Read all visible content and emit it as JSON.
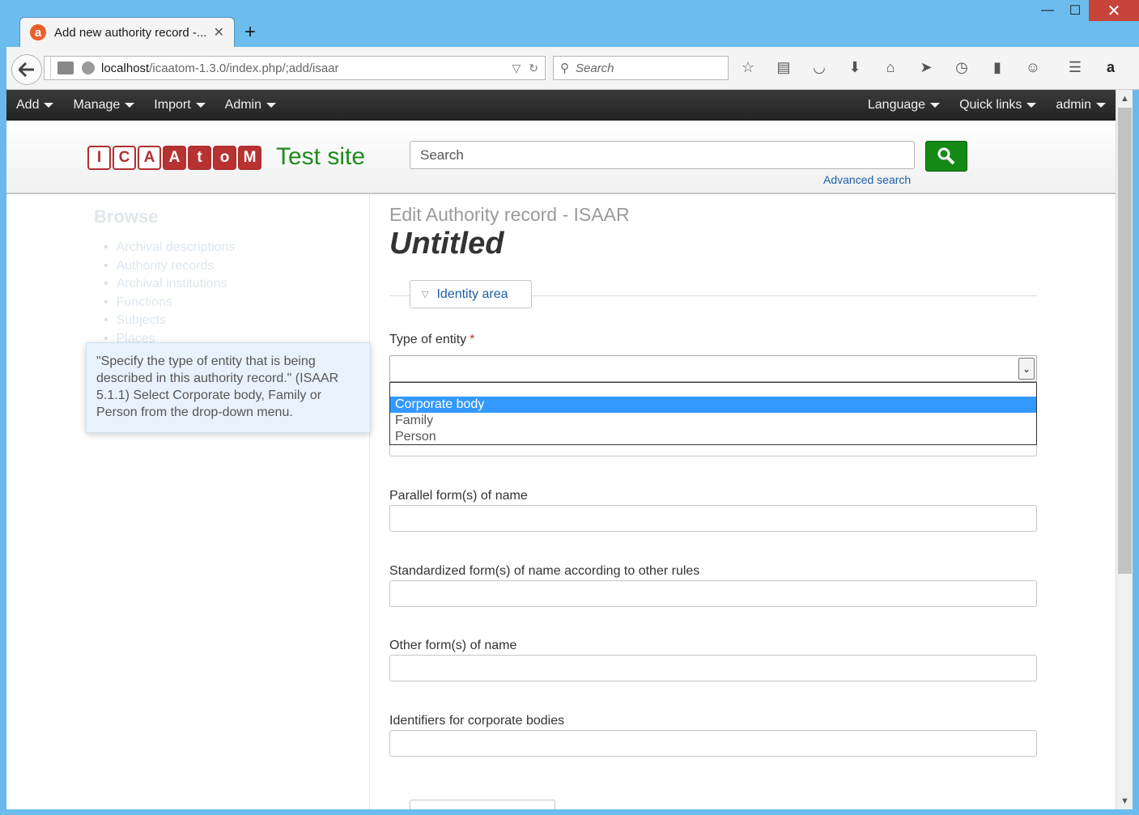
{
  "browser": {
    "tab_title": "Add new authority record -...",
    "tab_favicon": "a",
    "new_tab_label": "+",
    "url_host": "localhost",
    "url_path": "/icaatom-1.3.0/index.php/;add/isaar",
    "search_placeholder": "Search",
    "minimize": "—",
    "maximize": "☐",
    "close": "✕"
  },
  "topnav": {
    "left": [
      {
        "label": "Add"
      },
      {
        "label": "Manage"
      },
      {
        "label": "Import"
      },
      {
        "label": "Admin"
      }
    ],
    "right": [
      {
        "label": "Language"
      },
      {
        "label": "Quick links"
      },
      {
        "label": "admin"
      }
    ]
  },
  "header": {
    "logo_letters": [
      "I",
      "C",
      "A",
      "A",
      "t",
      "o",
      "M"
    ],
    "site_title": "Test site",
    "search_placeholder": "Search",
    "advanced_search": "Advanced search"
  },
  "sidebar": {
    "title": "Browse",
    "items": [
      {
        "label": "Archival descriptions"
      },
      {
        "label": "Authority records"
      },
      {
        "label": "Archival institutions"
      },
      {
        "label": "Functions"
      },
      {
        "label": "Subjects"
      },
      {
        "label": "Places"
      }
    ],
    "tooltip": "\"Specify the type of entity that is being described in this authority record.\" (ISAAR 5.1.1) Select Corporate body, Family or Person from the drop-down menu."
  },
  "main": {
    "heading": "Edit Authority record - ISAAR",
    "record_title": "Untitled",
    "section_tab": "Identity area",
    "type_of_entity": {
      "label": "Type of entity",
      "required_mark": "*",
      "value": "",
      "options": [
        "",
        "Corporate body",
        "Family",
        "Person"
      ],
      "highlighted": "Corporate body"
    },
    "fields": [
      {
        "label": "Parallel form(s) of name",
        "value": ""
      },
      {
        "label": "Standardized form(s) of name according to other rules",
        "value": ""
      },
      {
        "label": "Other form(s) of name",
        "value": ""
      },
      {
        "label": "Identifiers for corporate bodies",
        "value": ""
      }
    ]
  },
  "colors": {
    "accent_link": "#1a5fa8",
    "site_title": "#1d8b1d",
    "search_button": "#148a14",
    "dropdown_highlight": "#3399ff",
    "required": "#c03030"
  }
}
